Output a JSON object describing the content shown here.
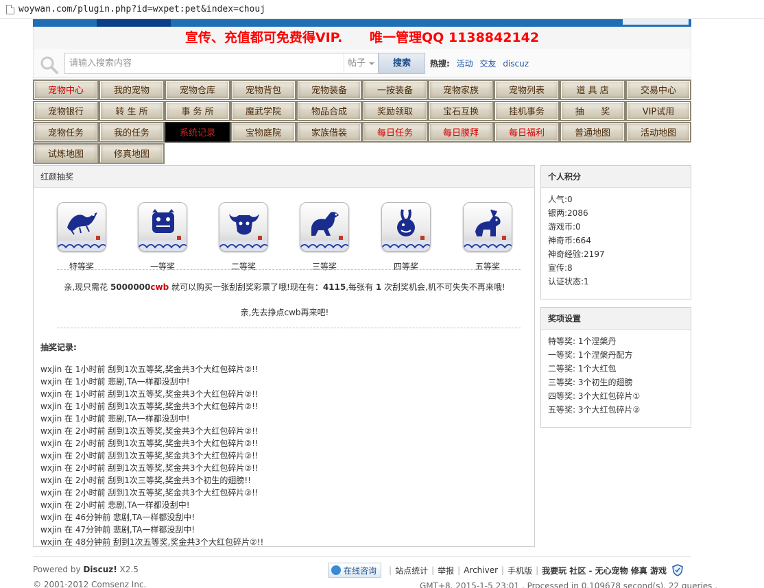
{
  "browser": {
    "url": "woywan.com/plugin.php?id=wxpet:pet&index=chouj"
  },
  "promo": {
    "text": "宣传、充值都可免费得VIP.      唯一管理QQ 1138842142"
  },
  "search": {
    "placeholder": "请输入搜索内容",
    "type": "帖子",
    "button": "搜索",
    "hot_label": "热搜:",
    "hot_items": [
      "活动",
      "交友",
      "discuz"
    ]
  },
  "nav": {
    "row1": [
      "宠物中心",
      "我的宠物",
      "宠物仓库",
      "宠物背包",
      "宠物装备",
      "一按装备",
      "宠物家族",
      "宠物列表",
      "道 具 店",
      "交易中心"
    ],
    "row2": [
      "宠物银行",
      "转 生 所",
      "事 务 所",
      "魔武学院",
      "物品合成",
      "奖励领取",
      "宝石互换",
      "挂机事务",
      "抽      奖",
      "VIP试用"
    ],
    "row3": [
      "宠物任务",
      "我的任务",
      "系统记录",
      "宝物庭院",
      "家族借装",
      "每日任务",
      "每日膜拜",
      "每日福利",
      "普通地图",
      "活动地图"
    ],
    "row4": [
      "试炼地图",
      "修真地图"
    ]
  },
  "lottery": {
    "title": "红颜抽奖",
    "prizes": [
      {
        "label": "特等奖",
        "icon": "dragon-icon"
      },
      {
        "label": "一等奖",
        "icon": "tiger-icon"
      },
      {
        "label": "二等奖",
        "icon": "ox-icon"
      },
      {
        "label": "三等奖",
        "icon": "horse-icon"
      },
      {
        "label": "四等奖",
        "icon": "rabbit-icon"
      },
      {
        "label": "五等奖",
        "icon": "goat-icon"
      }
    ],
    "msg_a": "亲,现只需花 ",
    "msg_cost": "5000000",
    "msg_cwb": "cwb",
    "msg_b": " 就可以购买一张刮刮奖彩票了哦!现在有：",
    "msg_have": "4115",
    "msg_c": ",每张有 ",
    "msg_chance": "1",
    "msg_d": " 次刮奖机会,机不可失失不再来哦!",
    "msg2": "亲,先去挣点cwb再来吧!",
    "records_title": "抽奖记录:",
    "records": [
      "wxjin 在 1小时前 刮到1次五等奖,奖金共3个大红包碎片②!!",
      "wxjin 在 1小时前 悲剧,TA一样都没刮中!",
      "wxjin 在 1小时前 刮到1次五等奖,奖金共3个大红包碎片②!!",
      "wxjin 在 1小时前 刮到1次五等奖,奖金共3个大红包碎片②!!",
      "wxjin 在 1小时前 悲剧,TA一样都没刮中!",
      "wxjin 在 2小时前 刮到1次五等奖,奖金共3个大红包碎片②!!",
      "wxjin 在 2小时前 刮到1次五等奖,奖金共3个大红包碎片②!!",
      "wxjin 在 2小时前 刮到1次五等奖,奖金共3个大红包碎片②!!",
      "wxjin 在 2小时前 刮到1次五等奖,奖金共3个大红包碎片②!!",
      "wxjin 在 2小时前 刮到1次三等奖,奖金共3个初生的翅膀!!",
      "wxjin 在 2小时前 刮到1次五等奖,奖金共3个大红包碎片②!!",
      "wxjin 在 2小时前 悲剧,TA一样都没刮中!",
      "wxjin 在 46分钟前 悲剧,TA一样都没刮中!",
      "wxjin 在 47分钟前 悲剧,TA一样都没刮中!",
      "wxjin 在 48分钟前 刮到1次五等奖,奖金共3个大红包碎片②!!"
    ]
  },
  "score": {
    "title": "个人积分",
    "items": [
      "人气:0",
      "银两:2086",
      "游戏币:0",
      "神奇币:664",
      "神奇经验:2197",
      "宣传:8",
      "认证状态:1"
    ]
  },
  "awards": {
    "title": "奖项设置",
    "items": [
      "特等奖: 1个涅槃丹",
      "一等奖: 1个涅槃丹配方",
      "二等奖: 1个大红包",
      "三等奖: 3个初生的翅膀",
      "四等奖: 3个大红包碎片①",
      "五等奖: 3个大红包碎片②"
    ]
  },
  "footer": {
    "powered_a": "Powered by ",
    "powered_b": "Discuz!",
    "powered_c": " X2.5",
    "copyright": "© 2001-2012 Comsenz Inc.",
    "online": "在线咨询",
    "links": [
      "站点统计",
      "举报",
      "Archiver",
      "手机版"
    ],
    "site": "我要玩 社区 - 无心宠物 修真 游戏",
    "gmt": "GMT+8, 2015-1-5 23:01 , Processed in 0.109678 second(s), 22 queries ."
  }
}
